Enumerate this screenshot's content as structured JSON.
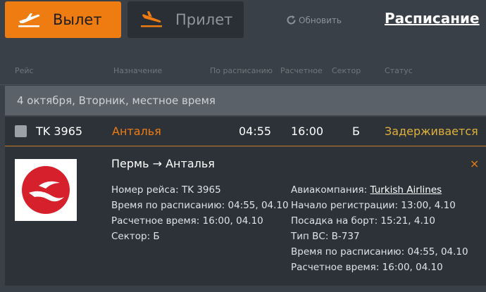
{
  "tabs": {
    "departure": "Вылет",
    "arrival": "Прилет"
  },
  "refresh_label": "Обновить",
  "schedule_link": "Расписание",
  "columns": {
    "flight": "Рейс",
    "destination": "Назначение",
    "scheduled": "По расписанию",
    "estimated": "Расчетное",
    "sector": "Сектор",
    "status": "Статус"
  },
  "date_band": "4 октября, Вторник, местное время",
  "flight": {
    "number": "TK 3965",
    "destination": "Анталья",
    "scheduled": "04:55",
    "estimated": "16:00",
    "sector": "Б",
    "status": "Задерживается"
  },
  "details": {
    "route": "Пермь → Анталья",
    "left": [
      "Номер рейса: TK 3965",
      "Время по расписанию: 04:55, 04.10",
      "Расчетное время: 16:00, 04.10",
      "Сектор: Б"
    ],
    "airline_label": "Авиакомпания: ",
    "airline_name": "Turkish Airlines",
    "right": [
      "Начало регистрации: 13:00, 4.10",
      "Посадка на борт: 15:21, 4.10",
      "Тип ВС: B-737",
      "Время по расписанию: 04:55, 04.10",
      "Расчетное время: 16:00, 04.10"
    ],
    "close": "×"
  },
  "colors": {
    "accent": "#ef7c10",
    "destination": "#ef7c10",
    "status": "#e0b13a"
  }
}
